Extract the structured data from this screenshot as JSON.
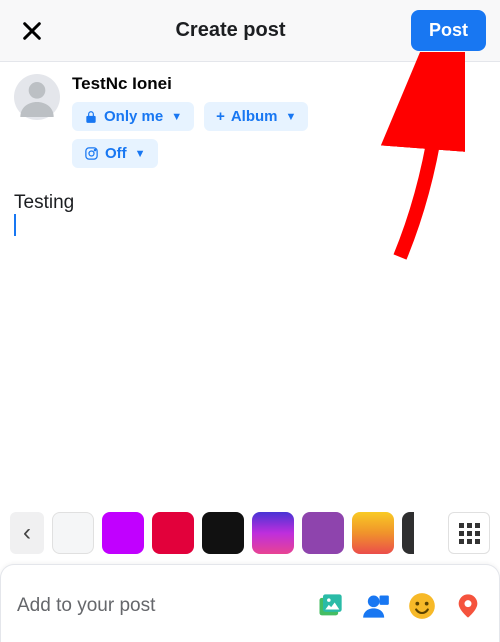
{
  "header": {
    "title": "Create post",
    "post_label": "Post"
  },
  "profile": {
    "name": "TestNc Ionei",
    "audience": {
      "label": "Only me"
    },
    "album": {
      "prefix": "+",
      "label": "Album"
    },
    "instagram": {
      "label": "Off"
    }
  },
  "composer": {
    "text": "Testing"
  },
  "backgrounds": {
    "prev_glyph": "‹",
    "swatches": [
      {
        "name": "none"
      },
      {
        "name": "magenta"
      },
      {
        "name": "red"
      },
      {
        "name": "black"
      },
      {
        "name": "sunset-gradient"
      },
      {
        "name": "purple"
      },
      {
        "name": "orange-gradient"
      },
      {
        "name": "dark-partial"
      }
    ]
  },
  "footer": {
    "label": "Add to your post",
    "tools": [
      {
        "name": "photo-video-icon",
        "color": "#45bd62"
      },
      {
        "name": "tag-people-icon",
        "color": "#1877f2"
      },
      {
        "name": "feeling-icon",
        "color": "#f7b928"
      },
      {
        "name": "location-icon",
        "color": "#f5533d"
      }
    ]
  },
  "annotation": {
    "type": "arrow",
    "points_to": "post-button",
    "color": "#ff0000"
  }
}
